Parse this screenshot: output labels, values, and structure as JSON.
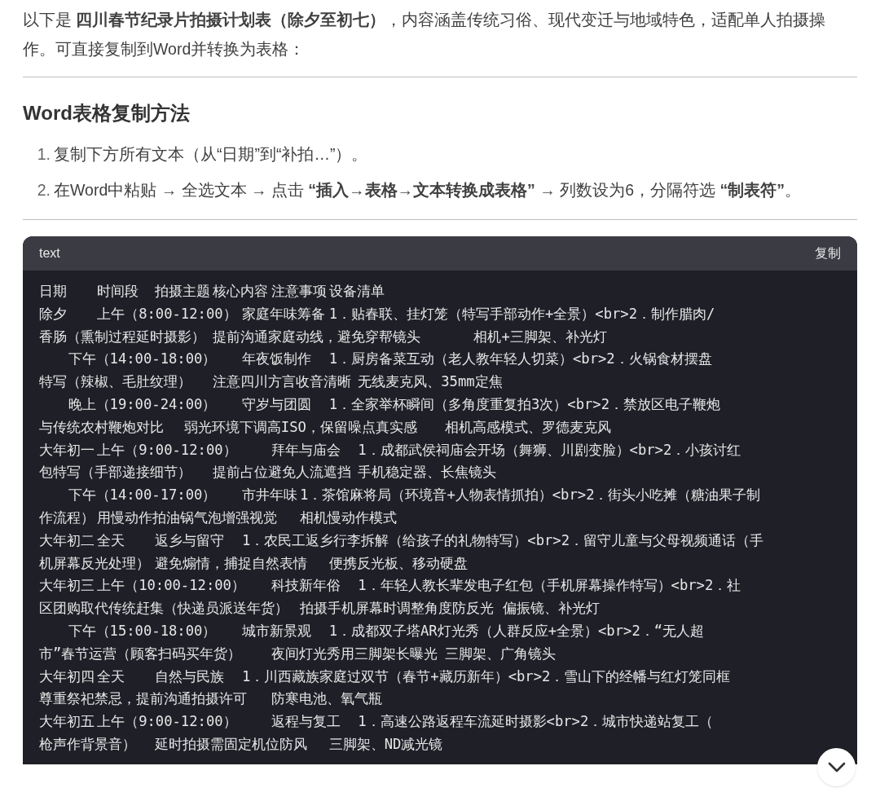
{
  "intro": "以下是 **四川春节纪录片拍摄计划表（除夕至初七）**，内容涵盖传统习俗、现代变迁与地域特色，适配单人拍摄操作。可直接复制到Word并转换为表格：",
  "section": {
    "heading": "Word表格复制方法",
    "steps": [
      {
        "number": "1.",
        "text": "复制下方所有文本（从“日期”到“补拍…”）。"
      },
      {
        "number": "2.",
        "text": "在Word中粘贴 → 全选文本 → 点击 **“插入→表格→文本转换成表格”** → 列数设为6，分隔符选 **“制表符”**。"
      }
    ]
  },
  "code_block": {
    "language": "text",
    "copy_button": "复制",
    "lines": [
      "日期\t时间段\t拍摄主题\t核心内容\t注意事项\t设备清单",
      "除夕\t上午（8:00-12:00）\t家庭年味筹备\t1．贴春联、挂灯笼（特写手部动作+全景）<br>2．制作腊肉/",
      "香肠（熏制过程延时摄影）\t提前沟通家庭动线，避免穿帮镜头\t\t相机+三脚架、补光灯",
      "\t下午（14:00-18:00）\t年夜饭制作\t1．厨房备菜互动（老人教年轻人切菜）<br>2．火锅食材摆盘",
      "特写（辣椒、毛肚纹理）\t注意四川方言收音清晰\t无线麦克风、35mm定焦",
      "\t晚上（19:00-24:00）\t守岁与团圆\t1．全家举杯瞬间（多角度重复拍3次）<br>2．禁放区电子鞭炮",
      "与传统农村鞭炮对比\t弱光环境下调高ISO，保留噪点真实感\t相机高感模式、罗德麦克风",
      "大年初一\t上午（9:00-12:00）\t\t拜年与庙会\t1．成都武侯祠庙会开场（舞狮、川剧变脸）<br>2．小孩讨红",
      "包特写（手部递接细节）\t提前占位避免人流遮挡\t手机稳定器、长焦镜头",
      "\t下午（14:00-17:00）\t市井年味\t1．茶馆麻将局（环境音+人物表情抓拍）<br>2．街头小吃摊（糖油果子制",
      "作流程）\t用慢动作拍油锅气泡增强视觉\t相机慢动作模式",
      "大年初二\t全天\t返乡与留守\t1．农民工返乡行李拆解（给孩子的礼物特写）<br>2．留守儿童与父母视频通话（手",
      "机屏幕反光处理）\t避免煽情，捕捉自然表情\t便携反光板、移动硬盘",
      "大年初三\t上午（10:00-12:00）\t科技新年俗\t1．年轻人教长辈发电子红包（手机屏幕操作特写）<br>2．社",
      "区团购取代传统赶集（快递员派送年货）\t拍摄手机屏幕时调整角度防反光\t偏振镜、补光灯",
      "\t下午（15:00-18:00）\t城市新景观\t1．成都双子塔AR灯光秀（人群反应+全景）<br>2．“无人超",
      "市”春节运营（顾客扫码买年货）\t夜间灯光秀用三脚架长曝光\t三脚架、广角镜头",
      "大年初四\t全天\t自然与民族\t1．川西藏族家庭过双节（春节+藏历新年）<br>2．雪山下的经幡与红灯笼同框",
      "尊重祭祀禁忌，提前沟通拍摄许可\t防寒电池、氧气瓶",
      "大年初五\t上午（9:00-12:00）\t\t返程与复工\t1．高速公路返程车流延时摄影<br>2．城市快递站复工（",
      "枪声作背景音）\t延时拍摄需固定机位防风\t三脚架、ND减光镜"
    ]
  }
}
